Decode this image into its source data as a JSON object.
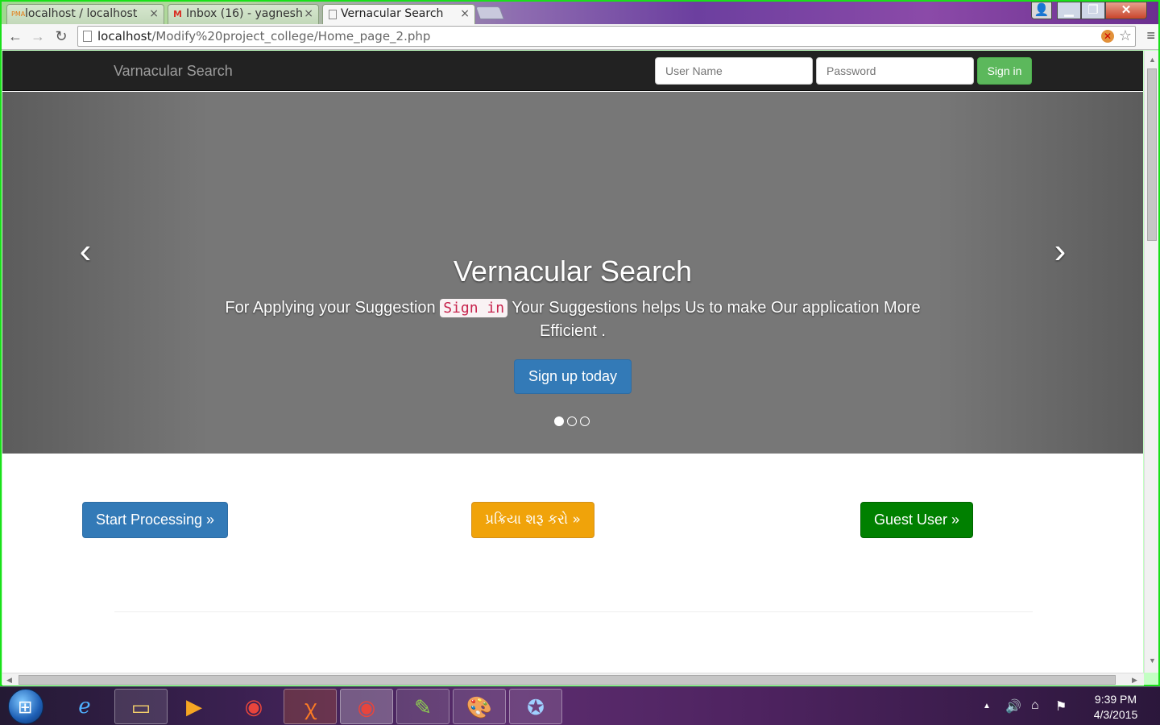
{
  "browser": {
    "tabs": [
      {
        "label": "localhost / localhost",
        "icon": "phpmyadmin-icon",
        "fav_text": "PMA",
        "close": "×"
      },
      {
        "label": "Inbox (16) - yagnesh",
        "icon": "gmail-icon",
        "fav_text": "M",
        "close": "×"
      },
      {
        "label": "Vernacular Search",
        "icon": "page-icon",
        "close": "×"
      }
    ],
    "url_host": "localhost",
    "url_path": "/Modify%20project_college/Home_page_2.php",
    "nav": {
      "back": "←",
      "forward": "→",
      "reload": "↻",
      "star": "☆",
      "menu": "≡",
      "ext": "✕"
    },
    "window_controls": {
      "user": "👤",
      "minimize": "▁",
      "maximize": "❐",
      "close": "✕"
    }
  },
  "page": {
    "brand": "Varnacular Search",
    "username_placeholder": "User Name",
    "password_placeholder": "Password",
    "signin_label": "Sign in",
    "carousel": {
      "heading": "Vernacular Search",
      "text_before": "For Applying your Suggestion",
      "code": "Sign in",
      "text_after": "Your Suggestions helps Us to make Our application More Efficient .",
      "button": "Sign up today",
      "prev": "‹",
      "next": "›",
      "slide_count": 3,
      "active_slide": 1
    },
    "buttons": {
      "start": "Start Processing »",
      "gujarati": "પ્રક્રિયા શરૂ કરો »",
      "guest": "Guest User »"
    }
  },
  "scrollbars": {
    "up": "▲",
    "down": "▼",
    "left": "◀",
    "right": "▶"
  },
  "taskbar": {
    "items": [
      "internet-explorer-icon",
      "file-explorer-icon",
      "media-player-icon",
      "chrome-icon",
      "xampp-icon",
      "chrome-active-icon",
      "notepad-plus-icon",
      "paint-icon",
      "safari-icon"
    ],
    "glyphs": {
      "ie": "e",
      "explorer": "▭",
      "media": "▶",
      "chrome": "◉",
      "xampp": "ꭓ",
      "notepad": "✎",
      "paint": "🎨",
      "safari": "✪"
    },
    "tray": {
      "arrow": "▲",
      "volume": "🔊",
      "network": "⌂",
      "flag": "⚑"
    },
    "time": "9:39 PM",
    "date": "4/3/2015"
  },
  "colors": {
    "navbar": "#222222",
    "signin_green": "#5cb85c",
    "primary_blue": "#337ab7",
    "orange": "#f0a30a",
    "guest_green": "#008000"
  }
}
